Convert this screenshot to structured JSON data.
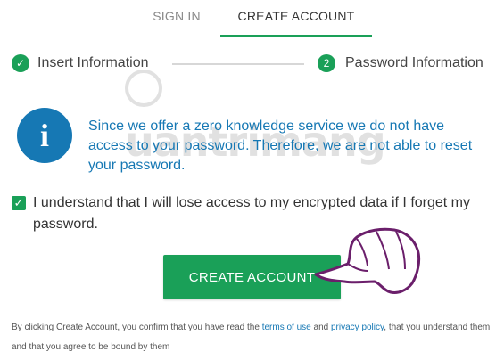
{
  "tabs": {
    "signin": "SIGN IN",
    "create": "CREATE ACCOUNT"
  },
  "steps": [
    {
      "badge": "✓",
      "label": "Insert Information"
    },
    {
      "badge": "2",
      "label": "Password Information"
    }
  ],
  "watermark": "uantrimang",
  "info": {
    "icon": "i",
    "text": "Since we offer a zero knowledge service we do not have access to your password. Therefore, we are not able to reset your password."
  },
  "agreement": {
    "checked_glyph": "✓",
    "text": "I understand that I will lose access to my encrypted data if I forget my password."
  },
  "create_button": "CREATE ACCOUNT",
  "footer": {
    "part1": "By clicking Create Account, you confirm that you have read the ",
    "terms_link": "terms of use",
    "part2": " and ",
    "privacy_link": "privacy policy",
    "part3": ", that you understand them and that you agree to be bound by them"
  },
  "colors": {
    "accent_green": "#1aa058",
    "info_blue": "#1678b4"
  }
}
